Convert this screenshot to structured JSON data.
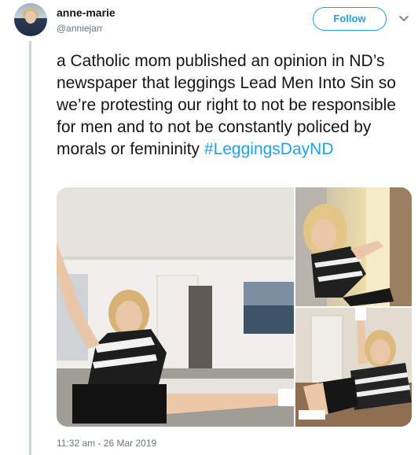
{
  "author": {
    "display_name": "anne-marie",
    "handle": "@anniejarr"
  },
  "follow_label": "Follow",
  "tweet": {
    "text": "a Catholic mom published an opinion in ND’s newspaper that leggings Lead Men Into Sin so we’re protesting our right to not be responsible for men and to not be constantly policed by morals or femininity ",
    "hashtag": "#LeggingsDayND"
  },
  "timestamp": "11:32 am - 26 Mar 2019",
  "colors": {
    "accent": "#1da1f2",
    "text": "#14171a",
    "muted": "#657786",
    "thread_line": "#ccd6dd"
  },
  "icons": [
    "chevron-down-icon"
  ]
}
